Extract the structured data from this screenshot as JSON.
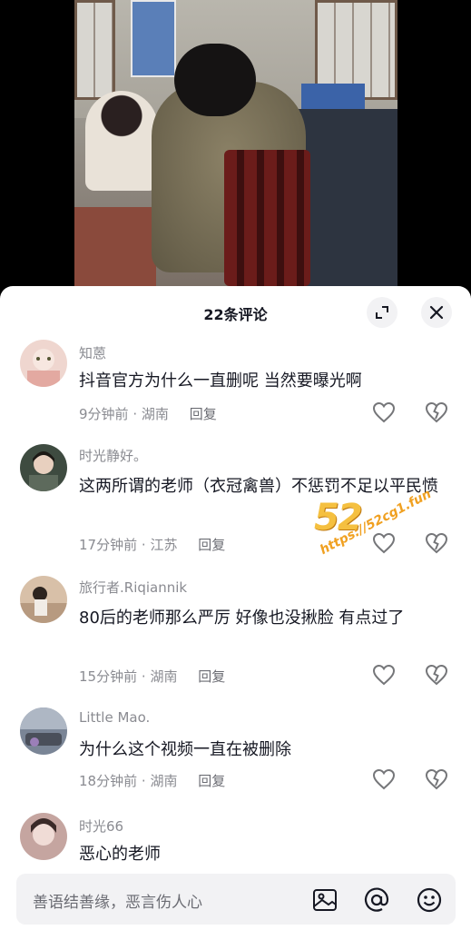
{
  "sheet": {
    "title": "22条评论"
  },
  "comments": [
    {
      "user": "知蒽",
      "text": "抖音官方为什么一直删呢  当然要曝光啊",
      "time": "9分钟前",
      "location": "湖南",
      "reply": "回复",
      "avatar_color": "#e7c8c0"
    },
    {
      "user": "时光静好。",
      "text": "这两所谓的老师（衣冠禽兽）不惩罚不足以平民愤",
      "time": "17分钟前",
      "location": "江苏",
      "reply": "回复",
      "avatar_color": "#3b4a3d"
    },
    {
      "user": "旅行者.Riqiannik",
      "text": "80后的老师那么严厉 好像也没揪脸 有点过了",
      "time": "15分钟前",
      "location": "湖南",
      "reply": "回复",
      "avatar_color": "#d9b7a0"
    },
    {
      "user": "Little Mao.",
      "text": "为什么这个视频一直在被删除",
      "time": "18分钟前",
      "location": "湖南",
      "reply": "回复",
      "avatar_color": "#6e7a8a"
    },
    {
      "user": "时光66",
      "text": "恶心的老师",
      "avatar_color": "#b58d8a"
    }
  ],
  "meta_separator": "·",
  "watermark": {
    "number": "52",
    "url": "https://52cg1.fun"
  },
  "input": {
    "placeholder": "善语结善缘，恶言伤人心"
  },
  "icons": {
    "expand": "expand-icon",
    "close": "close-icon",
    "like": "heart-icon",
    "dislike": "broken-heart-icon",
    "image": "image-icon",
    "mention": "at-icon",
    "emoji": "emoji-icon"
  }
}
